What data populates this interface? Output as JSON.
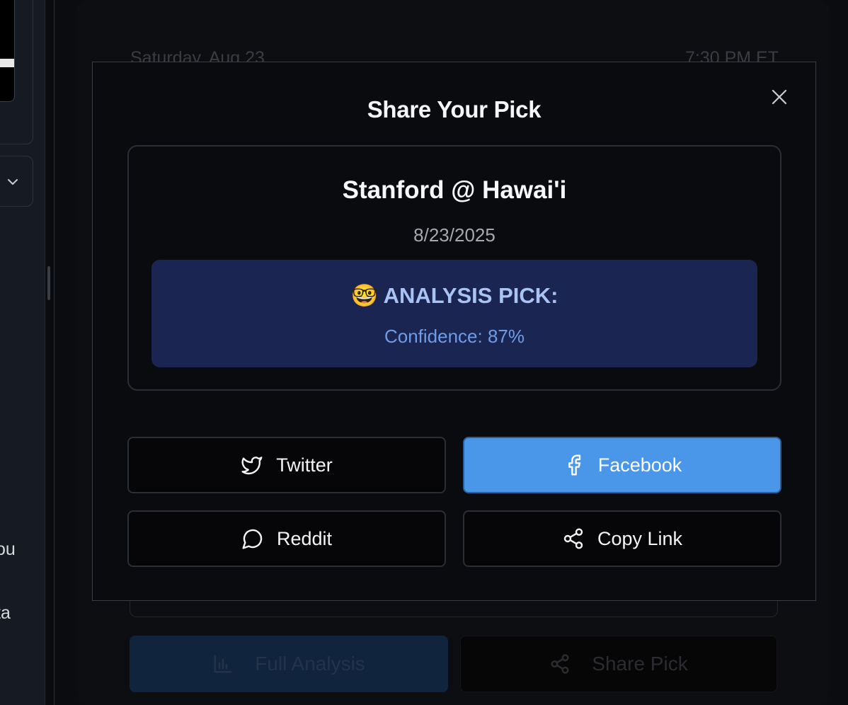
{
  "background": {
    "date": "Saturday, Aug 23",
    "time": "7:30 PM ET",
    "full_analysis_label": "Full Analysis",
    "share_pick_label": "Share Pick"
  },
  "sidebar": {
    "snippets": [
      "ou",
      "ta"
    ]
  },
  "modal": {
    "title": "Share Your Pick",
    "matchup": "Stanford @ Hawai'i",
    "date": "8/23/2025",
    "pick_emoji": "🤓",
    "pick_label": "ANALYSIS PICK:",
    "confidence": "Confidence: 87%",
    "buttons": {
      "twitter": "Twitter",
      "facebook": "Facebook",
      "reddit": "Reddit",
      "copy_link": "Copy Link"
    }
  },
  "colors": {
    "facebook_button": "#4a97e9",
    "pick_box": "#1b2551",
    "pick_text": "#a9c3f5",
    "confidence_text": "#6d9ce8"
  }
}
